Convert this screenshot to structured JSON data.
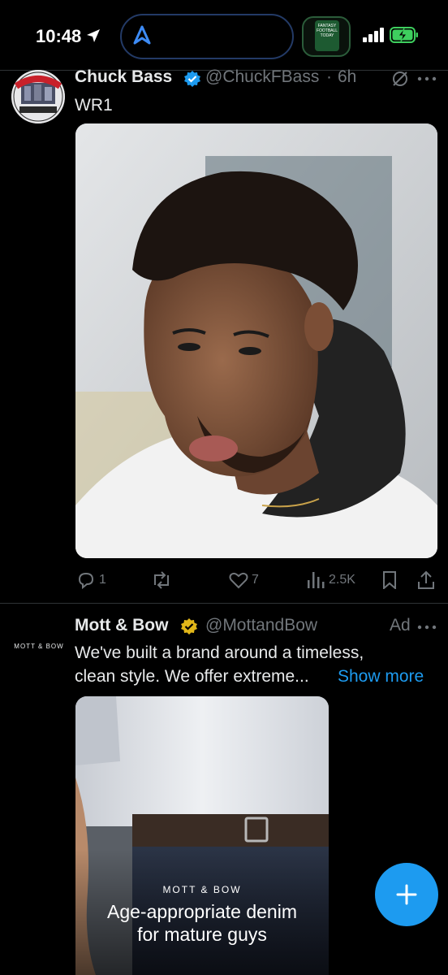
{
  "status_bar": {
    "time": "10:48",
    "podcast_art_text": "FANTASY FOOTBALL TODAY"
  },
  "tweet1": {
    "avatar_text": "THIS GUY SUCKS",
    "avatar_subtext": "WITH CHUCK BASS",
    "display_name": "Chuck Bass",
    "handle": "@ChuckFBass",
    "dot": "·",
    "time": "6h",
    "text": "WR1",
    "replies": "1",
    "retweets": "",
    "likes": "7",
    "views": "2.5K"
  },
  "tweet2": {
    "avatar_text": "MOTT & BOW",
    "display_name": "Mott & Bow",
    "handle": "@MottandBow",
    "ad_label": "Ad",
    "text_line1": "We've built a brand around a timeless,",
    "text_line2": "clean style. We offer extreme...",
    "show_more": "Show more",
    "media_brand": "MOTT & BOW",
    "media_caption_line1": "Age-appropriate denim",
    "media_caption_line2": "for mature guys"
  },
  "colors": {
    "accent": "#1d9bf0",
    "verified_blue": "#1d9bf0",
    "verified_gold": "#e2b719",
    "muted": "#71767b",
    "text": "#e7e9ea"
  }
}
